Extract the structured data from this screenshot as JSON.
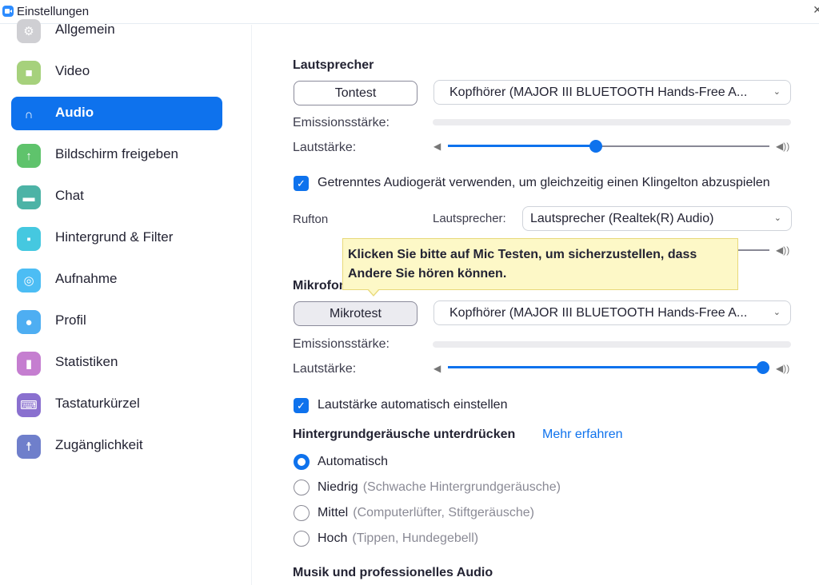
{
  "window": {
    "title": "Einstellungen",
    "close_glyph": "✕"
  },
  "sidebar": {
    "items": [
      {
        "label": "Allgemein",
        "icon": "gear-icon",
        "color": "#cfcfd3",
        "glyph": "⚙",
        "active": false
      },
      {
        "label": "Video",
        "icon": "video-camera-icon",
        "color": "#a6d17c",
        "glyph": "■",
        "active": false
      },
      {
        "label": "Audio",
        "icon": "headphones-icon",
        "color": "#0e72ed",
        "glyph": "∩",
        "active": true
      },
      {
        "label": "Bildschirm freigeben",
        "icon": "share-screen-icon",
        "color": "#5fc36c",
        "glyph": "↑",
        "active": false
      },
      {
        "label": "Chat",
        "icon": "chat-bubble-icon",
        "color": "#4cb3a6",
        "glyph": "▬",
        "active": false
      },
      {
        "label": "Hintergrund & Filter",
        "icon": "background-person-icon",
        "color": "#45c8e0",
        "glyph": "▪",
        "active": false
      },
      {
        "label": "Aufnahme",
        "icon": "record-icon",
        "color": "#4cbdf4",
        "glyph": "◎",
        "active": false
      },
      {
        "label": "Profil",
        "icon": "profile-icon",
        "color": "#4eaef2",
        "glyph": "●",
        "active": false
      },
      {
        "label": "Statistiken",
        "icon": "statistics-icon",
        "color": "#c57ed0",
        "glyph": "▮",
        "active": false
      },
      {
        "label": "Tastaturkürzel",
        "icon": "keyboard-icon",
        "color": "#8a70cf",
        "glyph": "⌨",
        "active": false
      },
      {
        "label": "Zugänglichkeit",
        "icon": "accessibility-icon",
        "color": "#6f7fcb",
        "glyph": "☨",
        "active": false
      }
    ]
  },
  "speaker": {
    "title": "Lautsprecher",
    "test_button": "Tontest",
    "device": "Kopfhörer (MAJOR III BLUETOOTH Hands-Free A...",
    "output_level_label": "Emissionsstärke:",
    "volume_label": "Lautstärke:",
    "volume_fraction": 0.46
  },
  "ringtone": {
    "separate_device_checked": true,
    "separate_device_label": "Getrenntes Audiogerät verwenden, um gleichzeitig einen Klingelton abzuspielen",
    "label": "Rufton",
    "speaker_label": "Lautsprecher:",
    "device": "Lautsprecher (Realtek(R) Audio)"
  },
  "tooltip": {
    "text_line1": "Klicken Sie bitte auf Mic Testen, um sicherzustellen, dass",
    "text_line2": "Andere Sie hören können."
  },
  "microphone": {
    "title": "Mikrofon",
    "test_button": "Mikrotest",
    "device": "Kopfhörer (MAJOR III BLUETOOTH Hands-Free A...",
    "input_level_label": "Emissionsstärke:",
    "volume_label": "Lautstärke:",
    "volume_fraction": 0.98,
    "auto_adjust_checked": true,
    "auto_adjust_label": "Lautstärke automatisch einstellen"
  },
  "noise_suppression": {
    "title": "Hintergrundgeräusche unterdrücken",
    "learn_more": "Mehr erfahren",
    "options": [
      {
        "label": "Automatisch",
        "hint": "",
        "checked": true
      },
      {
        "label": "Niedrig",
        "hint": "(Schwache Hintergrundgeräusche)",
        "checked": false
      },
      {
        "label": "Mittel",
        "hint": "(Computerlüfter, Stiftgeräusche)",
        "checked": false
      },
      {
        "label": "Hoch",
        "hint": "(Tippen, Hundegebell)",
        "checked": false
      }
    ]
  },
  "music": {
    "title": "Musik und professionelles Audio"
  },
  "icons": {
    "chevron": "⌄",
    "speaker_low": "◀",
    "speaker_high": "◀))",
    "check": "✓"
  }
}
